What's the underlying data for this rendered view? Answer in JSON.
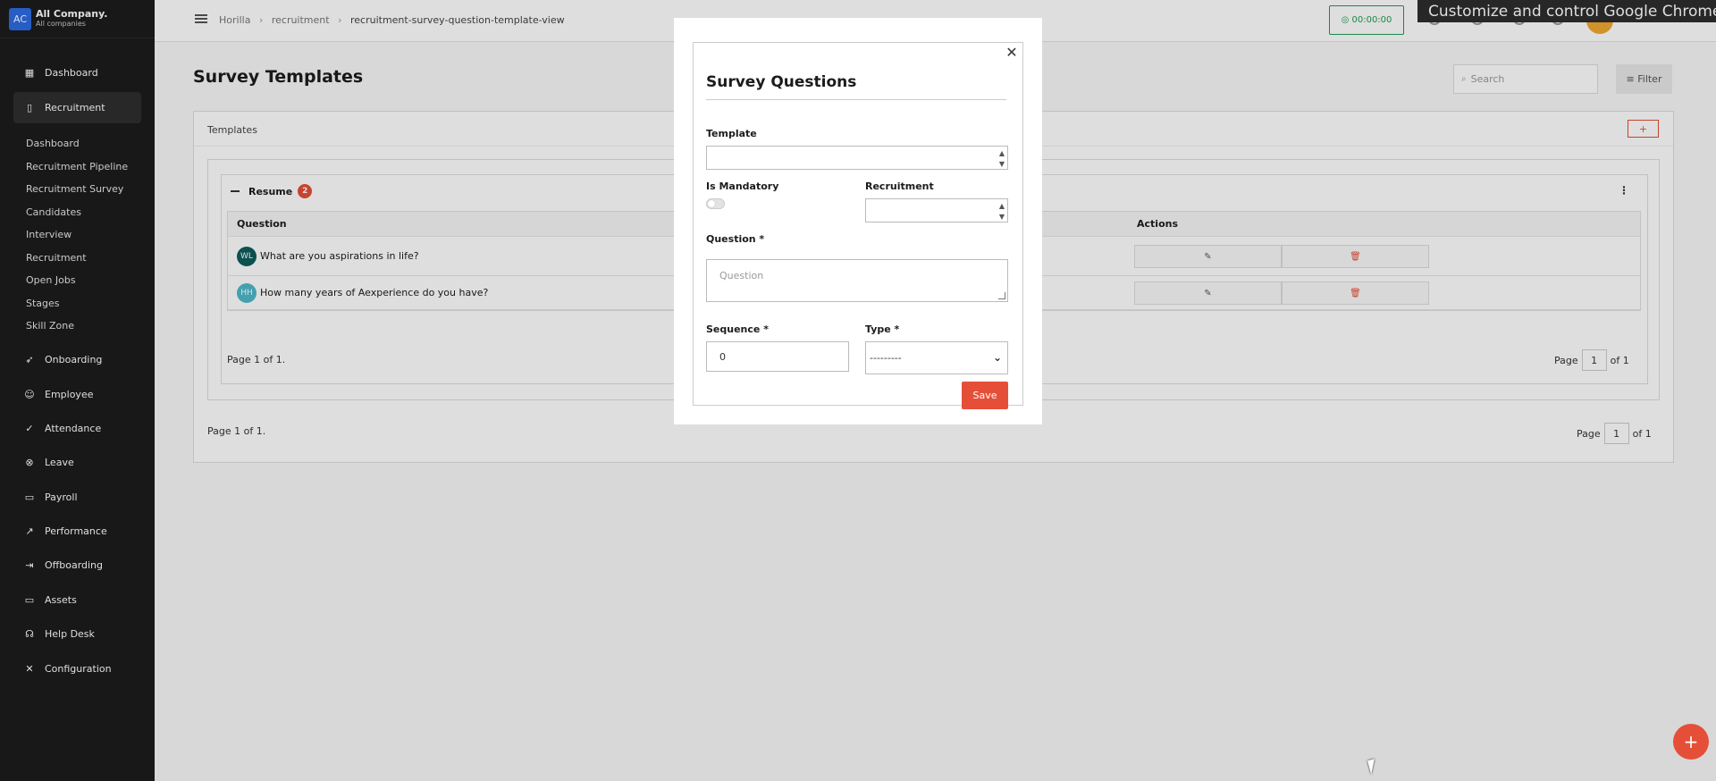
{
  "company": {
    "logo": "AC",
    "name": "All Company.",
    "sub": "All companies"
  },
  "sidebar": {
    "items": [
      {
        "label": "Dashboard",
        "icon": "dashboard-icon",
        "glyph": "▦"
      },
      {
        "label": "Recruitment",
        "icon": "recruitment-icon",
        "glyph": "▯"
      },
      {
        "label": "Onboarding",
        "icon": "rocket-icon",
        "glyph": "➶"
      },
      {
        "label": "Employee",
        "icon": "people-icon",
        "glyph": "☺"
      },
      {
        "label": "Attendance",
        "icon": "check-circle-icon",
        "glyph": "✓"
      },
      {
        "label": "Leave",
        "icon": "x-circle-icon",
        "glyph": "⊗"
      },
      {
        "label": "Payroll",
        "icon": "wallet-icon",
        "glyph": "▭"
      },
      {
        "label": "Performance",
        "icon": "chart-line-icon",
        "glyph": "↗"
      },
      {
        "label": "Offboarding",
        "icon": "exit-icon",
        "glyph": "⇥"
      },
      {
        "label": "Assets",
        "icon": "laptop-icon",
        "glyph": "▭"
      },
      {
        "label": "Help Desk",
        "icon": "headset-icon",
        "glyph": "☊"
      },
      {
        "label": "Configuration",
        "icon": "tools-icon",
        "glyph": "✕"
      }
    ],
    "recruitment_sub": [
      "Dashboard",
      "Recruitment Pipeline",
      "Recruitment Survey",
      "Candidates",
      "Interview",
      "Recruitment",
      "Open Jobs",
      "Stages",
      "Skill Zone"
    ]
  },
  "header": {
    "breadcrumb": [
      "Horilla",
      "recruitment",
      "recruitment-survey-question-template-view"
    ],
    "timer": "00:00:00",
    "chrome_tip": "Customize and control Google Chrome"
  },
  "main": {
    "title": "Survey Templates",
    "search_placeholder": "Search",
    "filter_label": "Filter",
    "panel_label": "Templates",
    "add_label": "+",
    "group": {
      "name": "Resume",
      "count": "2"
    },
    "table": {
      "headers": {
        "question": "Question",
        "actions": "Actions"
      },
      "rows": [
        {
          "initials": "WL",
          "color": "#0f5c5c",
          "text": "What are you aspirations in life?"
        },
        {
          "initials": "HH",
          "color": "#4fb8c9",
          "text": "How many years of Aexperience do you have?"
        }
      ]
    },
    "inner_page_text": "Page 1 of 1.",
    "outer_page_text": "Page 1 of 1.",
    "pager": {
      "label": "Page",
      "current": "1",
      "of": "of 1"
    }
  },
  "modal": {
    "title": "Survey Questions",
    "template_label": "Template",
    "is_mandatory_label": "Is Mandatory",
    "recruitment_label": "Recruitment",
    "question_label": "Question *",
    "question_placeholder": "Question",
    "sequence_label": "Sequence *",
    "sequence_value": "0",
    "type_label": "Type *",
    "type_value": "---------",
    "save_label": "Save"
  },
  "colors": {
    "accent": "#e54f38",
    "sidebar": "#1c1c1c",
    "timer": "#1f9d55"
  }
}
